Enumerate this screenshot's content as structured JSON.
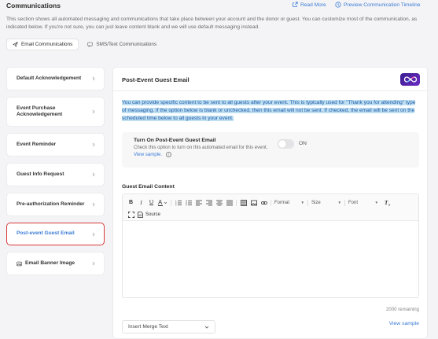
{
  "header": {
    "title": "Communications",
    "read_more": "Read More",
    "preview_timeline": "Preview Communication Timeline"
  },
  "description": "This section shows all automated messaging and communications that take place between your account and the donor or guest. You can customize most of the communication, as indicated below. If you're not sure, you can just leave content blank and we will use default messaging instead.",
  "tabs": [
    {
      "label": "Email Communications",
      "icon": "send-icon",
      "active": true
    },
    {
      "label": "SMS/Text Communications",
      "icon": "message-icon",
      "active": false
    }
  ],
  "sidebar": {
    "items": [
      {
        "label": "Default Acknowledgement",
        "active": false
      },
      {
        "label": "Event Purchase Acknowledgement",
        "active": false
      },
      {
        "label": "Event Reminder",
        "active": false
      },
      {
        "label": "Guest Info Request",
        "active": false
      },
      {
        "label": "Pre-authorization Reminder",
        "active": false
      },
      {
        "label": "Post-event Guest Email",
        "active": true
      },
      {
        "label": "Email Banner Image",
        "active": false,
        "icon": "image-icon"
      }
    ]
  },
  "panel": {
    "title": "Post-Event Guest Email",
    "info_text": "You can provide specific content to be sent to all guests after your event. This is typically used for \"Thank you for attending\" type of messaging. If the option below is blank or unchecked, then this email will not be sent. If checked, the email will be sent on the scheduled time below to all guests in your event.",
    "toggle": {
      "title": "Turn On Post-Event Guest Email",
      "description": "Check this option to turn on this automated email for this event.",
      "sample_link": "View sample.",
      "state_label": "ON",
      "enabled": false
    },
    "content_title": "Guest Email Content",
    "toolbar": {
      "format_label": "Format",
      "size_label": "Size",
      "font_label": "Font",
      "source_label": "Source"
    },
    "remaining": "2000 remaining",
    "merge_select": "Insert Merge Text",
    "view_sample": "View sample"
  },
  "colors": {
    "accent": "#3a7bd5",
    "highlight_bg": "#bfe0f3",
    "active_border": "#d93a3a"
  }
}
